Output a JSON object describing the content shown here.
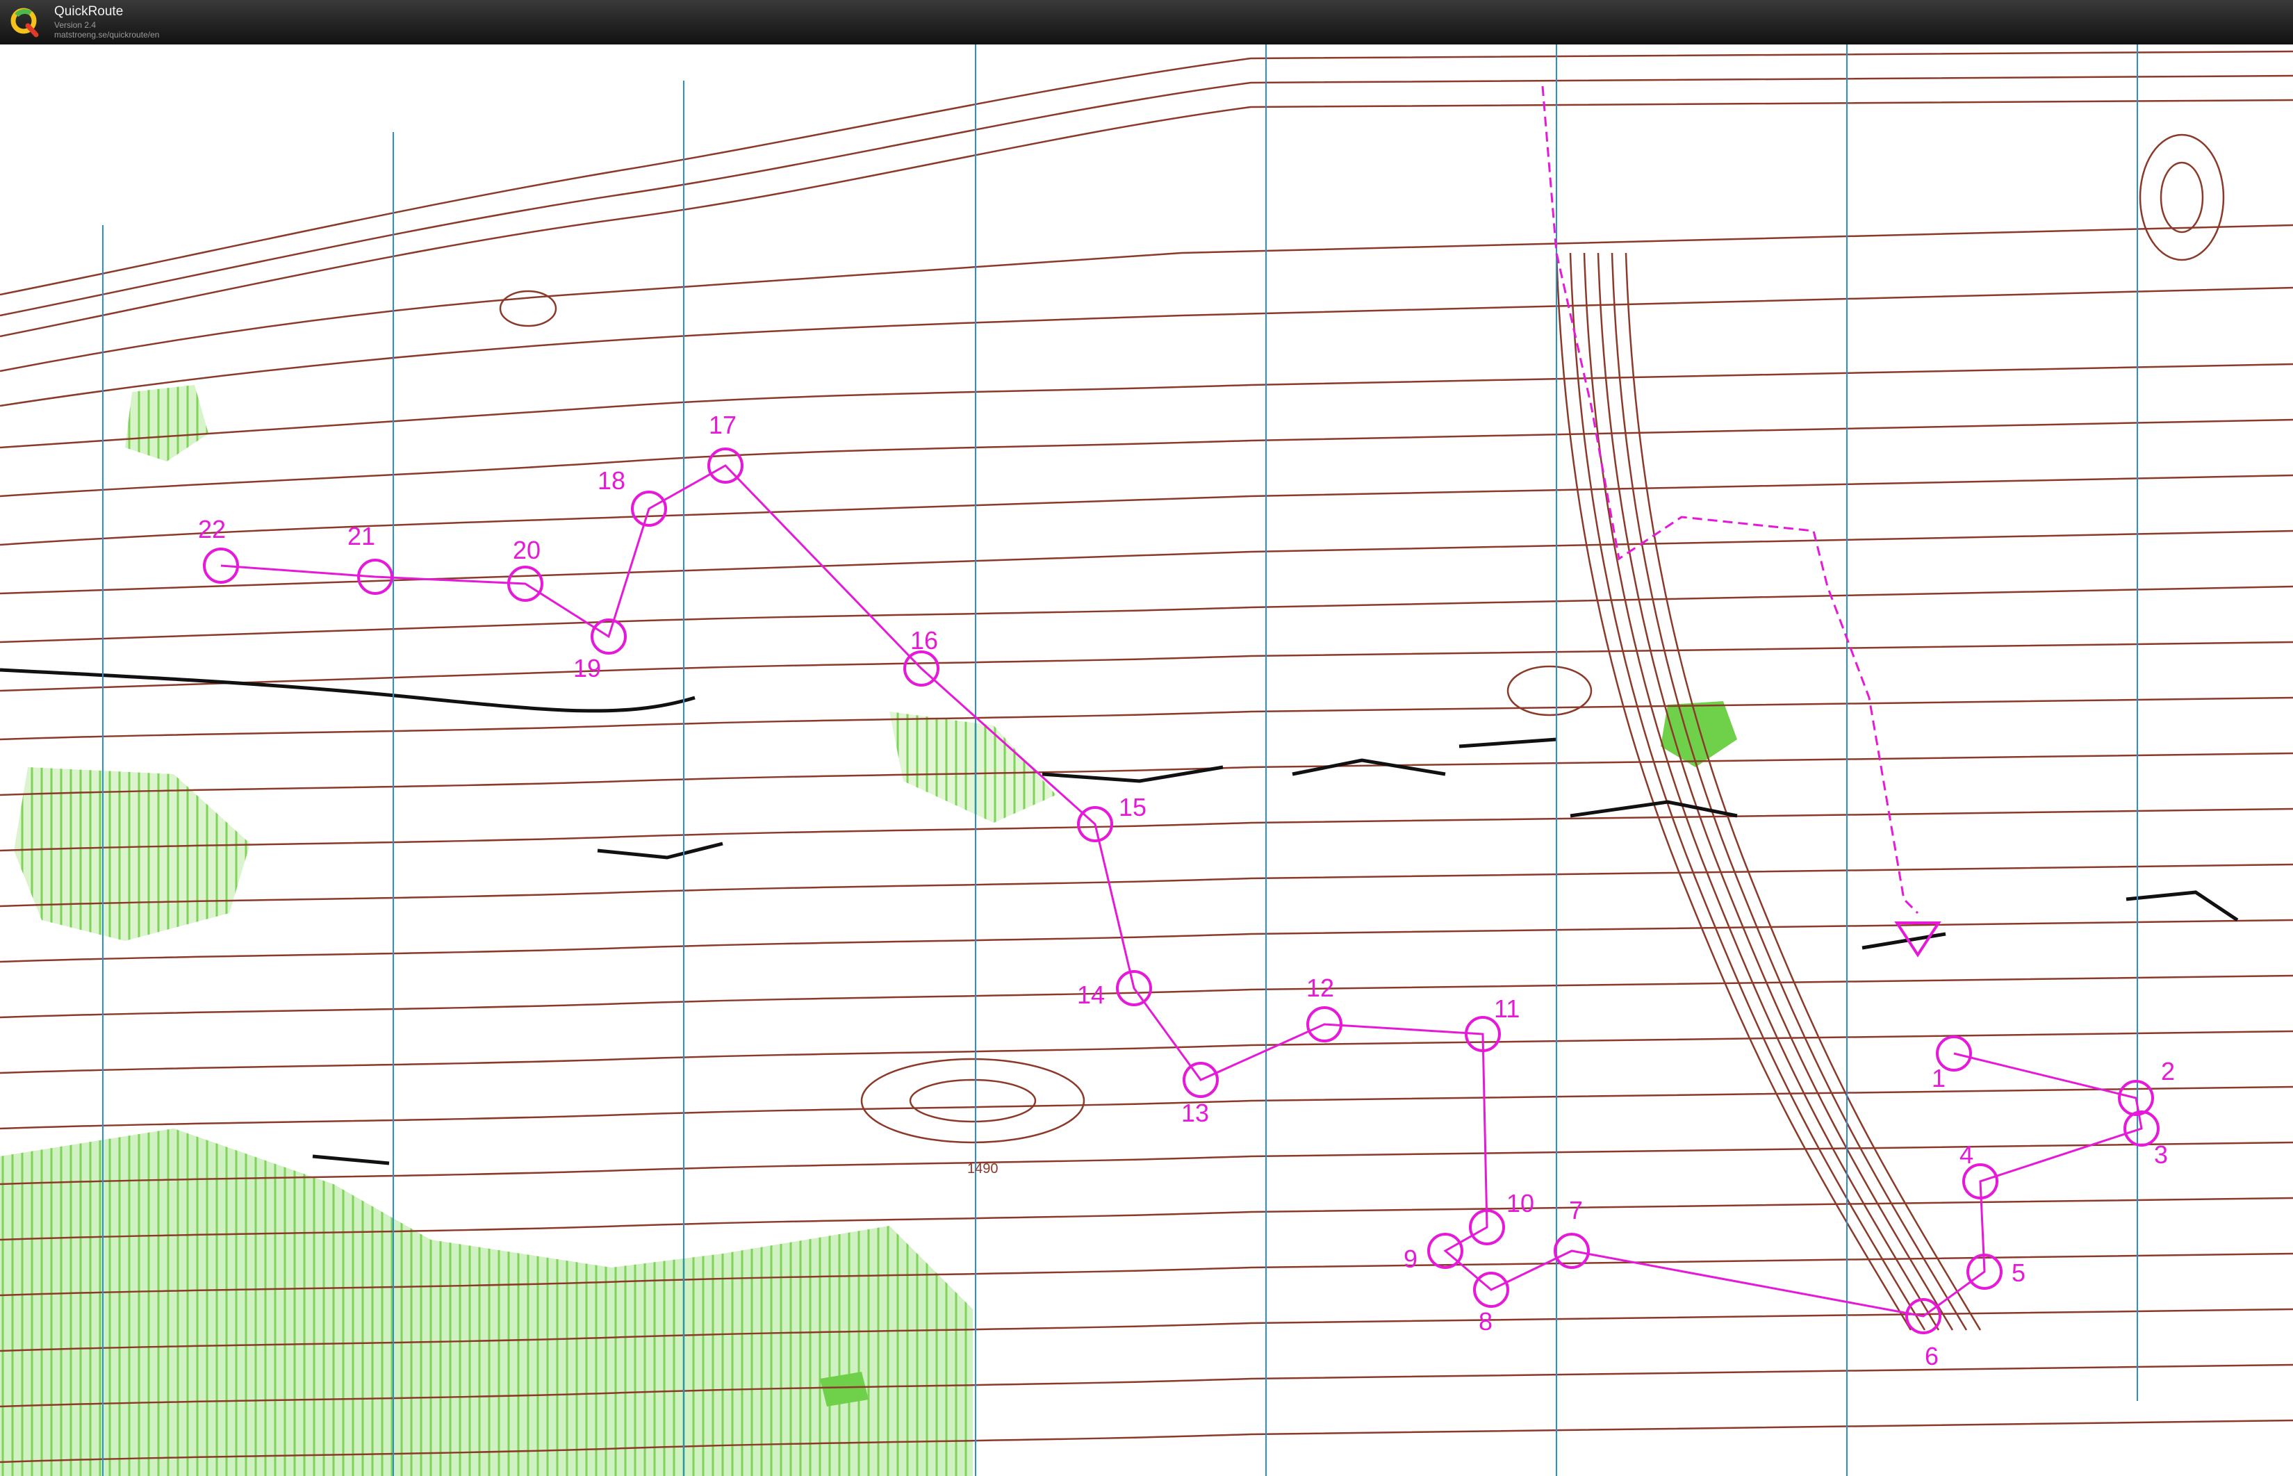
{
  "app": {
    "name": "QuickRoute",
    "version": "Version 2.4",
    "url": "matstroeng.se/quickroute/en",
    "logo_icon": "quickroute-q-logo-icon"
  },
  "map": {
    "colors": {
      "contour": "#8b3a2a",
      "rock": "#111111",
      "vegetation": "#7fd35a",
      "course": "#e619d8",
      "north_lines": "#2a8fd0",
      "background": "#ffffff"
    },
    "contour_label": "1490",
    "controls": [
      {
        "label": "1"
      },
      {
        "label": "2"
      },
      {
        "label": "3"
      },
      {
        "label": "4"
      },
      {
        "label": "5"
      },
      {
        "label": "6"
      },
      {
        "label": "7"
      },
      {
        "label": "8"
      },
      {
        "label": "9"
      },
      {
        "label": "10"
      },
      {
        "label": "11"
      },
      {
        "label": "12"
      },
      {
        "label": "13"
      },
      {
        "label": "14"
      },
      {
        "label": "15"
      },
      {
        "label": "16"
      },
      {
        "label": "17"
      },
      {
        "label": "18"
      },
      {
        "label": "19"
      },
      {
        "label": "20"
      },
      {
        "label": "21"
      },
      {
        "label": "22"
      }
    ]
  }
}
